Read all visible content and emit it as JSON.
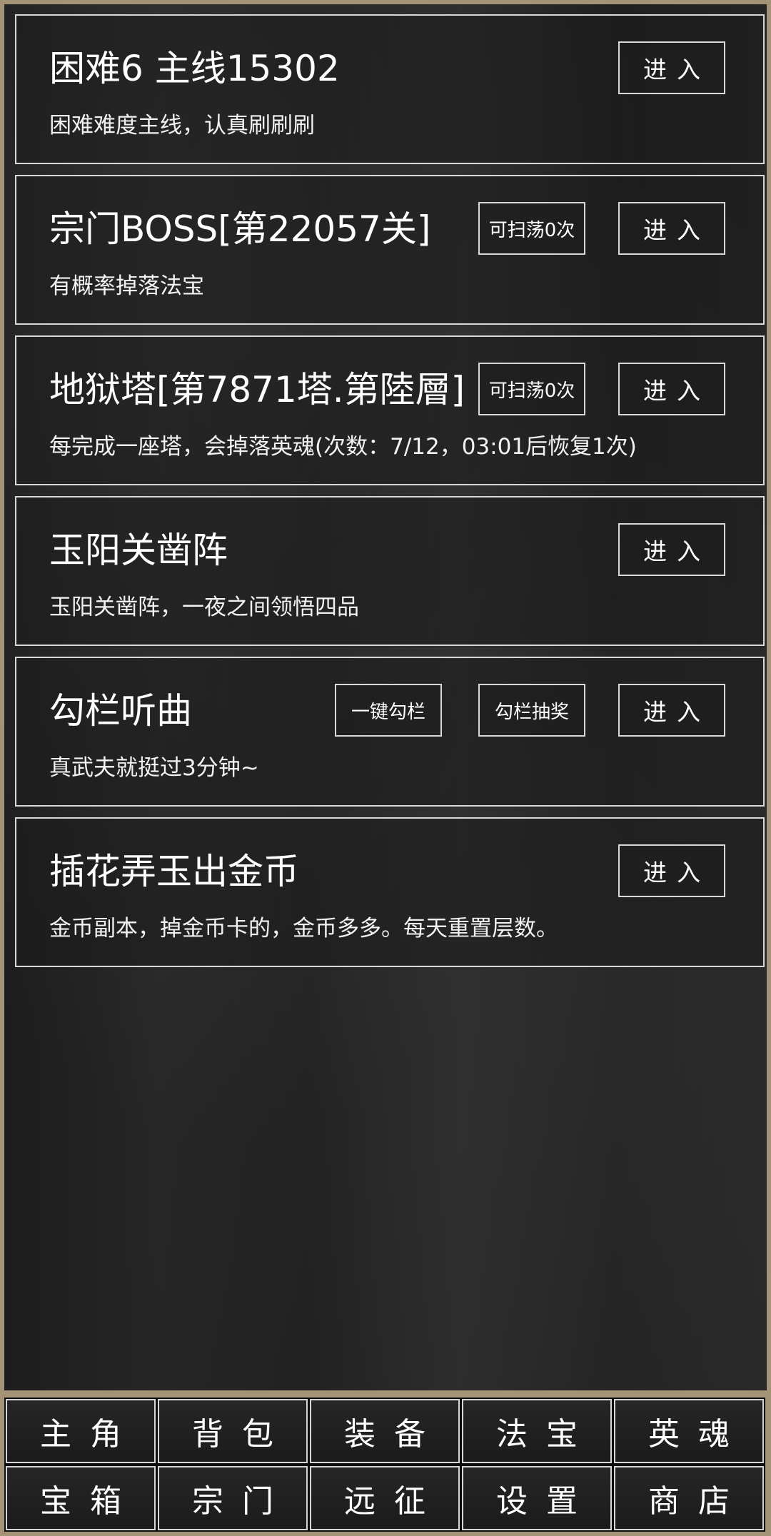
{
  "cards": [
    {
      "title": "困难6 主线15302",
      "desc": "困难难度主线，认真刷刷刷",
      "enter_label": "进入"
    },
    {
      "title": "宗门BOSS[第22057关]",
      "desc": "有概率掉落法宝",
      "enter_label": "进入",
      "sweep_label": "可扫荡0次"
    },
    {
      "title": "地狱塔[第7871塔.第陸層]",
      "desc": "每完成一座塔，会掉落英魂(次数：7/12，03:01后恢复1次)",
      "enter_label": "进入",
      "sweep_label": "可扫荡0次"
    },
    {
      "title": "玉阳关凿阵",
      "desc": "玉阳关凿阵，一夜之间领悟四品",
      "enter_label": "进入"
    },
    {
      "title": "勾栏听曲",
      "desc": "真武夫就挺过3分钟~",
      "enter_label": "进入",
      "lottery_label": "勾栏抽奖",
      "onekey_label": "一键勾栏"
    },
    {
      "title": "插花弄玉出金币",
      "desc": "金币副本，掉金币卡的，金币多多。每天重置层数。",
      "enter_label": "进入"
    }
  ],
  "tabs": [
    {
      "label": "主角"
    },
    {
      "label": "背包"
    },
    {
      "label": "装备"
    },
    {
      "label": "法宝"
    },
    {
      "label": "英魂"
    },
    {
      "label": "宝箱"
    },
    {
      "label": "宗门"
    },
    {
      "label": "远征"
    },
    {
      "label": "设置"
    },
    {
      "label": "商店"
    }
  ]
}
